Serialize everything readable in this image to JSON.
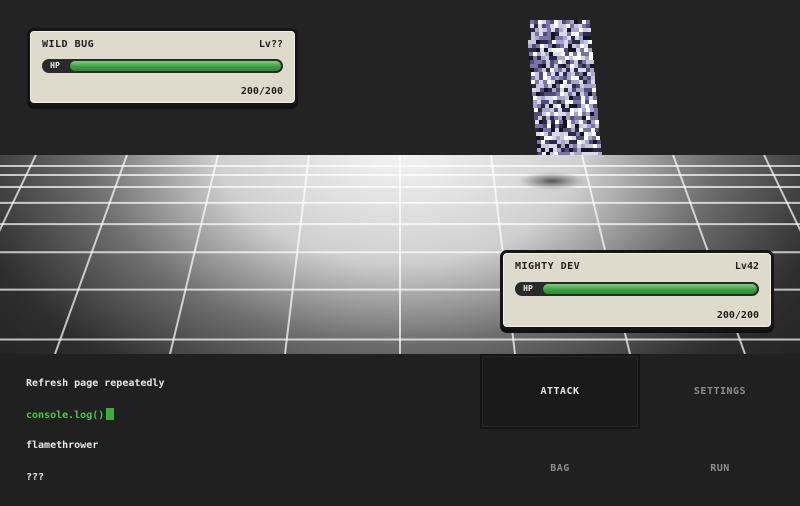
{
  "enemy": {
    "name": "WILD BUG",
    "level": "Lv??",
    "hp_label": "HP",
    "hp_text": "200/200",
    "hp_fraction": 1.0
  },
  "player": {
    "name": "MIGHTY DEV",
    "level": "Lv42",
    "hp_label": "HP",
    "hp_text": "200/200",
    "hp_fraction": 1.0
  },
  "log": {
    "lines": [
      "Refresh page repeatedly",
      "console.log()",
      "flamethrower",
      "???"
    ]
  },
  "actions": {
    "attack": "ATTACK",
    "settings": "SETTINGS",
    "bag": "BAG",
    "run": "RUN"
  },
  "colors": {
    "hp_green": "#3f9e43",
    "console_green": "#4cc94c",
    "panel": "#dedbcc"
  },
  "icons": {
    "enemy_sprite": "glitch-bug-sprite"
  }
}
